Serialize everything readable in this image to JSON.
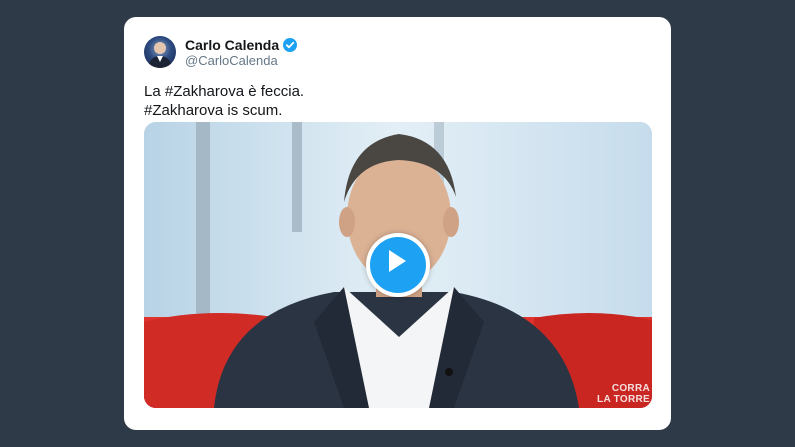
{
  "tweet": {
    "author_name": "Carlo Calenda",
    "handle": "@CarloCalenda",
    "verified": true,
    "text_lines": [
      "La #Zakharova è feccia.",
      "#Zakharova is scum."
    ]
  },
  "media": {
    "type": "video",
    "play_icon": "play-icon",
    "watermark_lines": [
      "CORRA",
      "LA TORRE"
    ]
  },
  "icons": {
    "verified": "verified-badge-icon",
    "play": "play-icon"
  },
  "colors": {
    "background": "#2f3a49",
    "card": "#ffffff",
    "accent": "#1da1f2",
    "name": "#14171a",
    "handle": "#657786"
  }
}
